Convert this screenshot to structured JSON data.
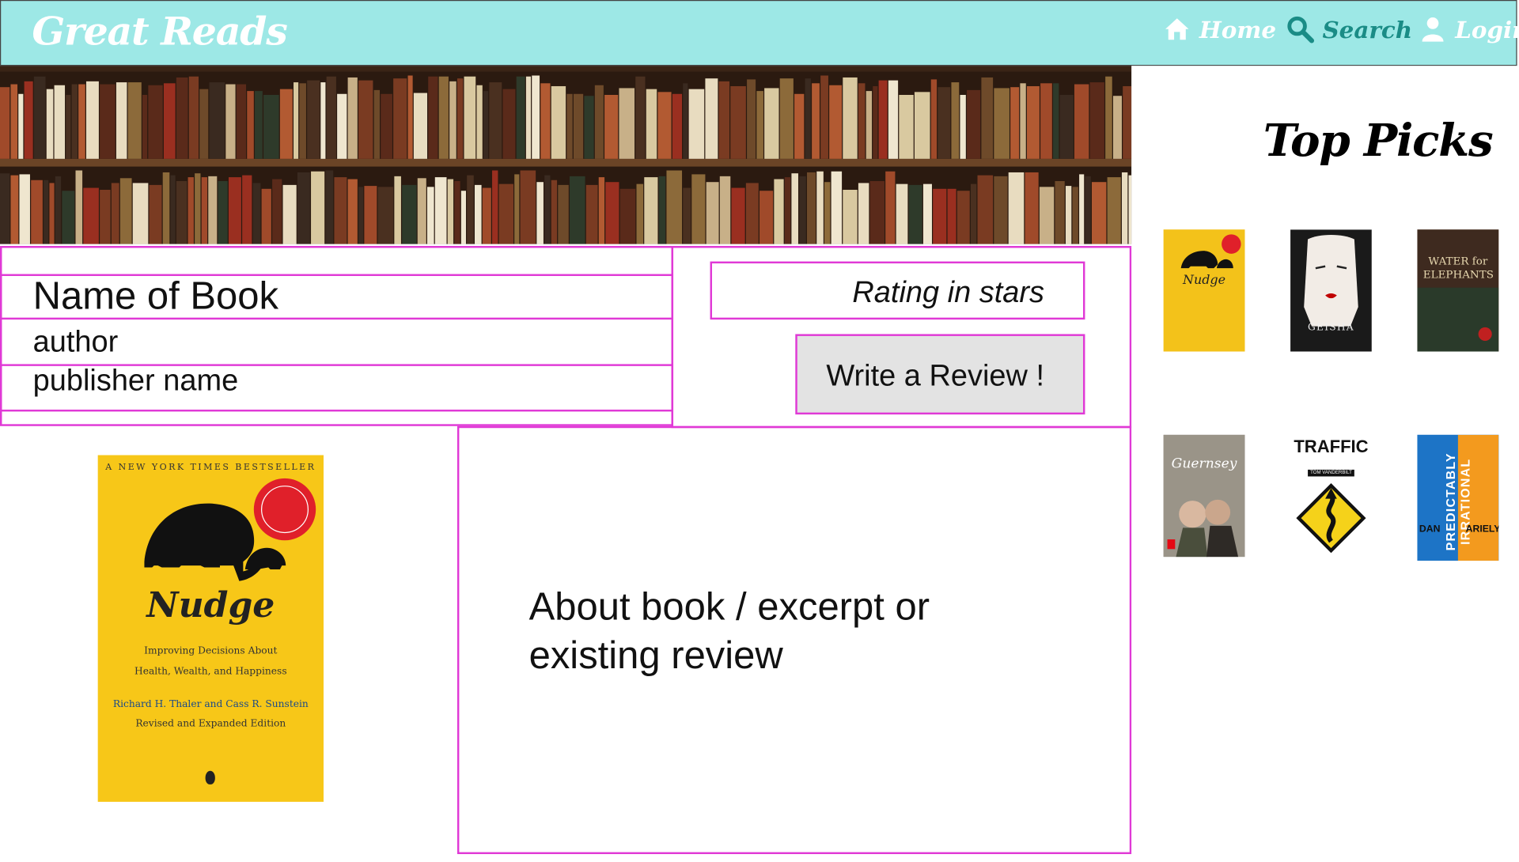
{
  "header": {
    "logo": "Great Reads",
    "nav": [
      {
        "label": "Home",
        "icon": "home-icon"
      },
      {
        "label": "Search",
        "icon": "search-icon"
      },
      {
        "label": "Login",
        "icon": "user-icon"
      }
    ]
  },
  "book": {
    "title": "Name of Book",
    "author": "author",
    "publisher": "publisher name",
    "rating": "Rating in stars",
    "review_button": "Write a Review !",
    "about": "About book / excerpt or existing review"
  },
  "cover": {
    "title": "Nudge",
    "top_line": "A NEW YORK TIMES BESTSELLER",
    "subtitle_1": "Improving Decisions About",
    "subtitle_2": "Health, Wealth, and Happiness",
    "authors": "Richard H. Thaler and Cass R. Sunstein",
    "edition": "Revised and Expanded Edition"
  },
  "sidebar": {
    "title": "Top Picks",
    "picks": [
      {
        "title": "Nudge",
        "color": "#f3c21a"
      },
      {
        "title": "GEISHA",
        "color": "#f2f2f2"
      },
      {
        "title": "WATER for ELEPHANTS",
        "color": "#5c3a2a"
      },
      {
        "title": "Guernsey",
        "color": "#8f8a80"
      },
      {
        "title": "TRAFFIC",
        "color": "#ffffff"
      },
      {
        "title": "PREDICTABLY IRRATIONAL",
        "color": "#1d74c6"
      }
    ],
    "traffic_sub": "TOM VANDERBILT",
    "predictably_author_1": "DAN",
    "predictably_author_2": "ARIELY"
  },
  "colors": {
    "header_bg": "#9de8e6",
    "box_border": "#e039d6",
    "button_bg": "#e3e3e3"
  }
}
